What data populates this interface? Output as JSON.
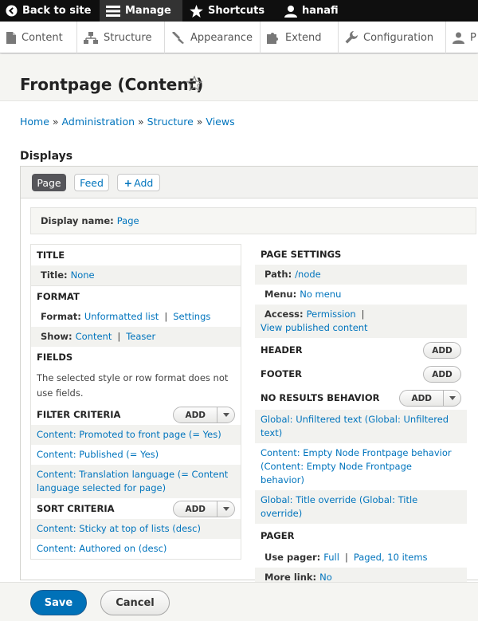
{
  "toolbar": {
    "back": "Back to site",
    "manage": "Manage",
    "shortcuts": "Shortcuts",
    "user": "hanafi"
  },
  "tray": {
    "content": "Content",
    "structure": "Structure",
    "appearance": "Appearance",
    "extend": "Extend",
    "configuration": "Configuration",
    "people": "P"
  },
  "page": {
    "title": "Frontpage (Content)"
  },
  "breadcrumb": {
    "home": "Home",
    "administration": "Administration",
    "structure": "Structure",
    "views": "Views",
    "sep": "»"
  },
  "displays": {
    "heading": "Displays",
    "tabs": {
      "page": "Page",
      "feed": "Feed",
      "add": "Add"
    },
    "display_name_label": "Display name:",
    "display_name_value": "Page"
  },
  "left": {
    "title": {
      "heading": "TITLE",
      "label": "Title:",
      "value": "None"
    },
    "format": {
      "heading": "FORMAT",
      "format_label": "Format:",
      "format_value": "Unformatted list",
      "settings": "Settings",
      "show_label": "Show:",
      "show_value": "Content",
      "teaser": "Teaser"
    },
    "fields": {
      "heading": "FIELDS",
      "note": "The selected style or row format does not use fields."
    },
    "filter": {
      "heading": "FILTER CRITERIA",
      "add": "Add",
      "items": [
        "Content: Promoted to front page (= Yes)",
        "Content: Published (= Yes)",
        "Content: Translation language (= Content language selected for page)"
      ]
    },
    "sort": {
      "heading": "SORT CRITERIA",
      "add": "Add",
      "items": [
        "Content: Sticky at top of lists (desc)",
        "Content: Authored on (desc)"
      ]
    }
  },
  "right": {
    "page_settings": {
      "heading": "PAGE SETTINGS",
      "path_label": "Path:",
      "path_value": "/node",
      "menu_label": "Menu:",
      "menu_value": "No menu",
      "access_label": "Access:",
      "access_value": "Permission",
      "access_detail": "View published content"
    },
    "header": {
      "heading": "HEADER",
      "add": "Add"
    },
    "footer": {
      "heading": "FOOTER",
      "add": "Add"
    },
    "no_results": {
      "heading": "NO RESULTS BEHAVIOR",
      "add": "Add",
      "items": [
        "Global: Unfiltered text (Global: Unfiltered text)",
        "Content: Empty Node Frontpage behavior (Content: Empty Node Frontpage behavior)",
        "Global: Title override (Global: Title override)"
      ]
    },
    "pager": {
      "heading": "PAGER",
      "use_label": "Use pager:",
      "use_value": "Full",
      "use_detail": "Paged, 10 items",
      "more_label": "More link:",
      "more_value": "No"
    }
  },
  "actions": {
    "save": "Save",
    "cancel": "Cancel"
  }
}
